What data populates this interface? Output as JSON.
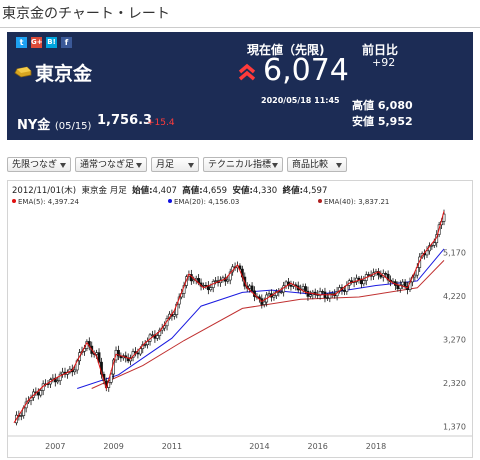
{
  "page": {
    "title": "東京金のチャート・レート"
  },
  "share": {
    "icons": [
      "twitter-icon",
      "google-plus-icon",
      "hatena-bookmark-icon",
      "facebook-icon"
    ],
    "glyphs": [
      "t",
      "G+",
      "B!",
      "f"
    ],
    "colors": [
      "#1da1f2",
      "#dd4b39",
      "#00a4de",
      "#3b5998"
    ]
  },
  "product": {
    "name": "東京金"
  },
  "ny_gold": {
    "label": "NY金",
    "date": "(05/15)",
    "value": "1,756.3",
    "change": "+15.4"
  },
  "current": {
    "label": "現在値（先限)",
    "price": "6,074",
    "timestamp": "2020/05/18 11:45"
  },
  "prev_diff": {
    "label": "前日比",
    "value": "+92"
  },
  "high": {
    "label": "高値",
    "value": "6,080"
  },
  "low": {
    "label": "安値",
    "value": "5,952"
  },
  "controls": {
    "contract_select": "先限つなぎ",
    "series_select": "通常つなぎ足",
    "period_select": "月足",
    "indicator_select": "テクニカル指標",
    "compare_select": "商品比較"
  },
  "ohlc_info": {
    "date": "2012/11/01(木)",
    "name": "東京金 月足",
    "open_label": "始値:",
    "open": "4,407",
    "high_label": "高値:",
    "high": "4,659",
    "low_label": "安値:",
    "low": "4,330",
    "close_label": "終値:",
    "close": "4,597"
  },
  "ema_legend": [
    {
      "label": "EMA(5): 4,397.24",
      "color": "#e01010"
    },
    {
      "label": "EMA(20): 4,156.03",
      "color": "#1010e0"
    },
    {
      "label": "EMA(40): 3,837.21",
      "color": "#b02020"
    }
  ],
  "colors": {
    "header_bg": "#1c2c55",
    "up": "#ff3b3b",
    "candle": "#111111",
    "ema5": "#e01010",
    "ema20": "#1a1ae0",
    "ema40": "#c03030"
  },
  "chart_data": {
    "type": "candlestick",
    "period": "monthly",
    "x_ticks": [
      "2007",
      "2009",
      "2011",
      "2014",
      "2016",
      "2018"
    ],
    "y_ticks": [
      1370,
      2320,
      3270,
      4220,
      5170
    ],
    "y_tick_labels": [
      "1,370",
      "2,320",
      "3,270",
      "4,220",
      "5,170"
    ],
    "ylim": [
      1250,
      6100
    ],
    "xlim": [
      "2005-08",
      "2020-05"
    ],
    "x_tick_dates": [
      "2007-01",
      "2009-01",
      "2011-01",
      "2014-01",
      "2016-01",
      "2018-01"
    ],
    "grid": false,
    "close_path": [
      [
        "2005-08",
        1450
      ],
      [
        "2006-02",
        1950
      ],
      [
        "2006-08",
        2250
      ],
      [
        "2007-02",
        2450
      ],
      [
        "2007-08",
        2600
      ],
      [
        "2008-02",
        3200
      ],
      [
        "2008-06",
        2900
      ],
      [
        "2008-10",
        2200
      ],
      [
        "2009-02",
        2950
      ],
      [
        "2009-08",
        2850
      ],
      [
        "2010-02",
        3200
      ],
      [
        "2010-08",
        3450
      ],
      [
        "2011-02",
        3900
      ],
      [
        "2011-08",
        4700
      ],
      [
        "2012-02",
        4400
      ],
      [
        "2012-11",
        4597
      ],
      [
        "2013-04",
        4900
      ],
      [
        "2013-08",
        4400
      ],
      [
        "2014-02",
        4100
      ],
      [
        "2014-08",
        4300
      ],
      [
        "2015-02",
        4500
      ],
      [
        "2015-08",
        4300
      ],
      [
        "2016-02",
        4250
      ],
      [
        "2016-08",
        4250
      ],
      [
        "2017-02",
        4500
      ],
      [
        "2017-08",
        4600
      ],
      [
        "2018-02",
        4750
      ],
      [
        "2018-08",
        4500
      ],
      [
        "2019-02",
        4400
      ],
      [
        "2019-08",
        5100
      ],
      [
        "2020-02",
        5500
      ],
      [
        "2020-05",
        6074
      ]
    ],
    "ema20_path": [
      [
        "2007-10",
        2200
      ],
      [
        "2009-03",
        2500
      ],
      [
        "2011-01",
        3300
      ],
      [
        "2012-01",
        4000
      ],
      [
        "2013-06",
        4300
      ],
      [
        "2014-06",
        4350
      ],
      [
        "2016-01",
        4250
      ],
      [
        "2018-01",
        4450
      ],
      [
        "2019-06",
        4550
      ],
      [
        "2020-05",
        5250
      ]
    ],
    "ema40_path": [
      [
        "2008-04",
        2200
      ],
      [
        "2010-01",
        2700
      ],
      [
        "2011-06",
        3250
      ],
      [
        "2013-06",
        3950
      ],
      [
        "2015-06",
        4150
      ],
      [
        "2017-06",
        4200
      ],
      [
        "2019-06",
        4400
      ],
      [
        "2020-05",
        5000
      ]
    ]
  }
}
